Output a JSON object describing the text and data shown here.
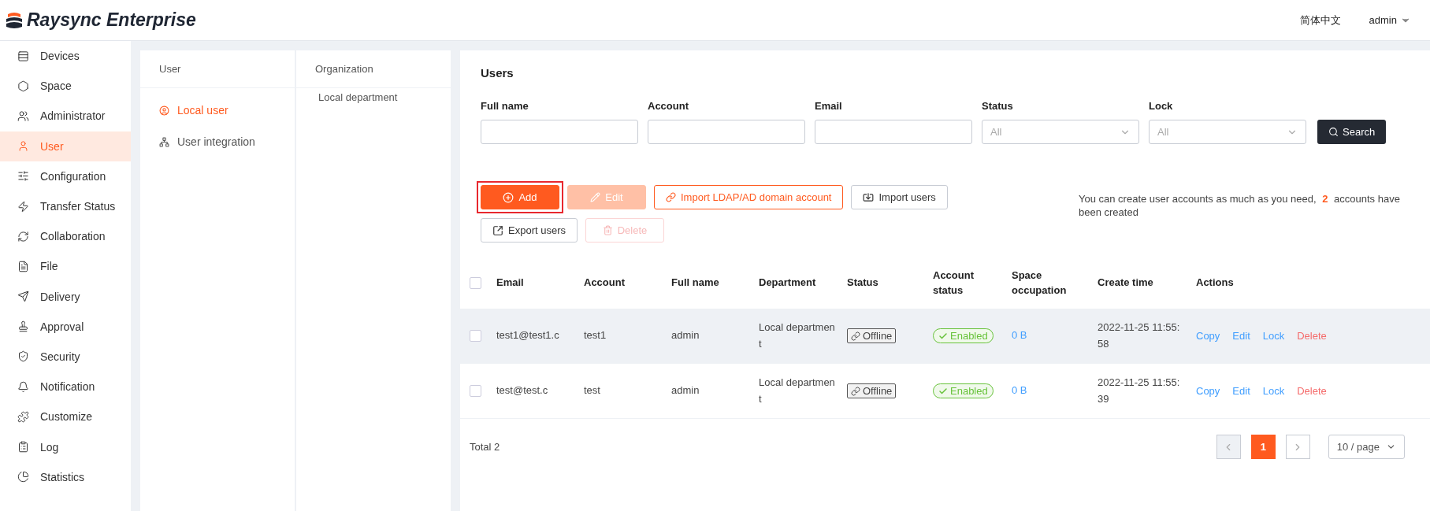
{
  "header": {
    "brand": "Raysync Enterprise",
    "language": "简体中文",
    "user": "admin"
  },
  "sidebar": {
    "items": [
      {
        "label": "Devices",
        "selected": false
      },
      {
        "label": "Space",
        "selected": false
      },
      {
        "label": "Administrator",
        "selected": false
      },
      {
        "label": "User",
        "selected": true
      },
      {
        "label": "Configuration",
        "selected": false
      },
      {
        "label": "Transfer Status",
        "selected": false
      },
      {
        "label": "Collaboration",
        "selected": false
      },
      {
        "label": "File",
        "selected": false
      },
      {
        "label": "Delivery",
        "selected": false
      },
      {
        "label": "Approval",
        "selected": false
      },
      {
        "label": "Security",
        "selected": false
      },
      {
        "label": "Notification",
        "selected": false
      },
      {
        "label": "Customize",
        "selected": false
      },
      {
        "label": "Log",
        "selected": false
      },
      {
        "label": "Statistics",
        "selected": false
      }
    ]
  },
  "user_panel": {
    "title": "User",
    "items": [
      {
        "label": "Local user",
        "selected": true
      },
      {
        "label": "User integration",
        "selected": false
      }
    ]
  },
  "organization_panel": {
    "title": "Organization",
    "items": [
      {
        "label": "Local department"
      }
    ]
  },
  "users": {
    "title": "Users",
    "filters": [
      {
        "label": "Full name",
        "kind": "text"
      },
      {
        "label": "Account",
        "kind": "text"
      },
      {
        "label": "Email",
        "kind": "text"
      },
      {
        "label": "Status",
        "kind": "select",
        "placeholder": "All"
      },
      {
        "label": "Lock",
        "kind": "select",
        "placeholder": "All"
      }
    ],
    "search_button": "Search",
    "actions": [
      {
        "label": "Add",
        "kind": "primary",
        "disabled": false,
        "highlighted": true
      },
      {
        "label": "Edit",
        "kind": "primary",
        "disabled": true,
        "highlighted": false
      },
      {
        "label": "Import LDAP/AD domain account",
        "kind": "accent"
      },
      {
        "label": "Import users",
        "kind": "import"
      },
      {
        "label": "Export users",
        "kind": "export"
      },
      {
        "label": "Delete",
        "kind": "danger",
        "disabled": true,
        "highlighted": false
      }
    ],
    "note": "You can create user accounts as much as you need, **2** accounts have been created",
    "table": {
      "select_all": {
        "checked": false
      },
      "columns": [
        "Email",
        "Account",
        "Full name",
        "Department",
        "Status",
        "Account status",
        "Space occupation",
        "Create time",
        "Actions"
      ],
      "rows": [
        {
          "checked": false,
          "hovered": true,
          "email": "test1@test1.c",
          "account": "test1",
          "full_name": "admin",
          "department": "Local department",
          "status": "Offline",
          "account_status": "Enabled",
          "space": "0 B",
          "create_time": "2022-11-25 11:55:58",
          "actions": [
            "Copy",
            "Edit",
            "Lock",
            "Delete"
          ]
        },
        {
          "checked": false,
          "hovered": false,
          "email": "test@test.c",
          "account": "test",
          "full_name": "admin",
          "department": "Local department",
          "status": "Offline",
          "account_status": "Enabled",
          "space": "0 B",
          "create_time": "2022-11-25 11:55:39",
          "actions": [
            "Copy",
            "Edit",
            "Lock",
            "Delete"
          ]
        }
      ]
    },
    "footer": {
      "total": "Total 2",
      "pages": [
        {
          "label": "1",
          "selected": true
        }
      ],
      "page_size": "10 / page"
    }
  }
}
